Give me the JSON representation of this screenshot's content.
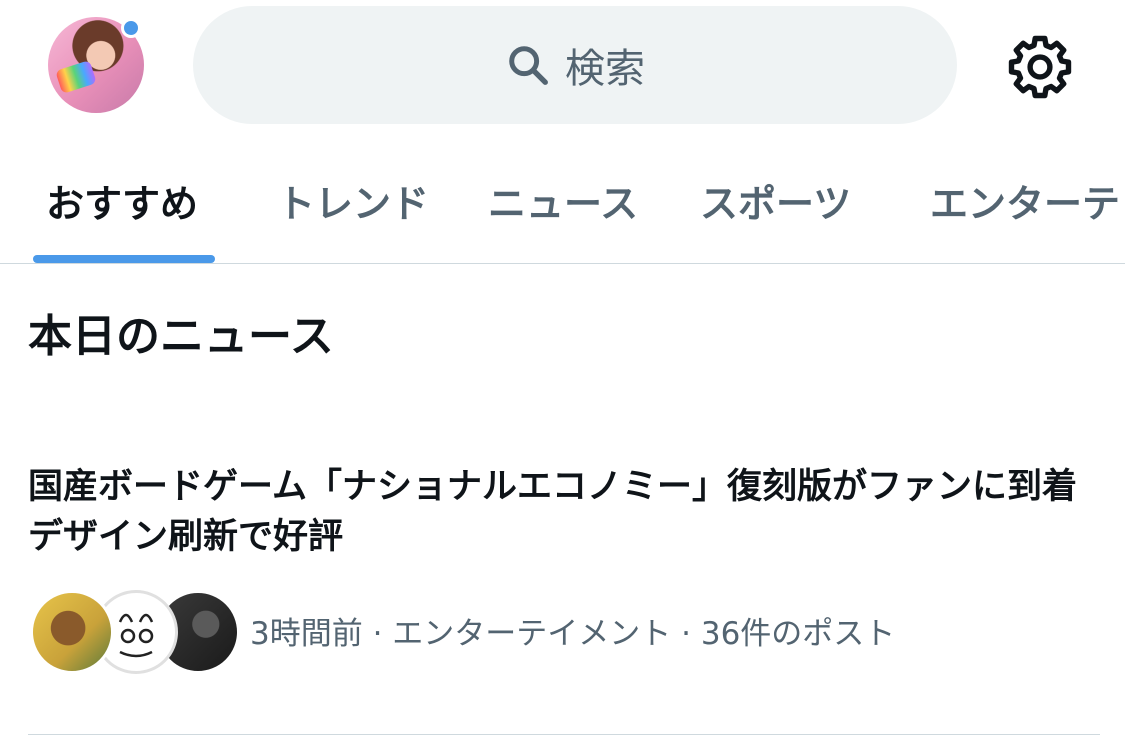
{
  "header": {
    "search_placeholder": "検索",
    "avatar_alt": "profile",
    "accent_color": "#4a99e9"
  },
  "tabs": [
    {
      "label": "おすすめ",
      "active": true
    },
    {
      "label": "トレンド",
      "active": false
    },
    {
      "label": "ニュース",
      "active": false
    },
    {
      "label": "スポーツ",
      "active": false
    },
    {
      "label": "エンターテ",
      "active": false
    }
  ],
  "section": {
    "title": "本日のニュース"
  },
  "article": {
    "headline": "国産ボードゲーム「ナショナルエコノミー」復刻版がファンに到着 デザイン刷新で好評",
    "meta": "3時間前 · エンターテイメント · 36件のポスト"
  },
  "icons": {
    "search": "search-icon",
    "settings": "gear-icon"
  }
}
